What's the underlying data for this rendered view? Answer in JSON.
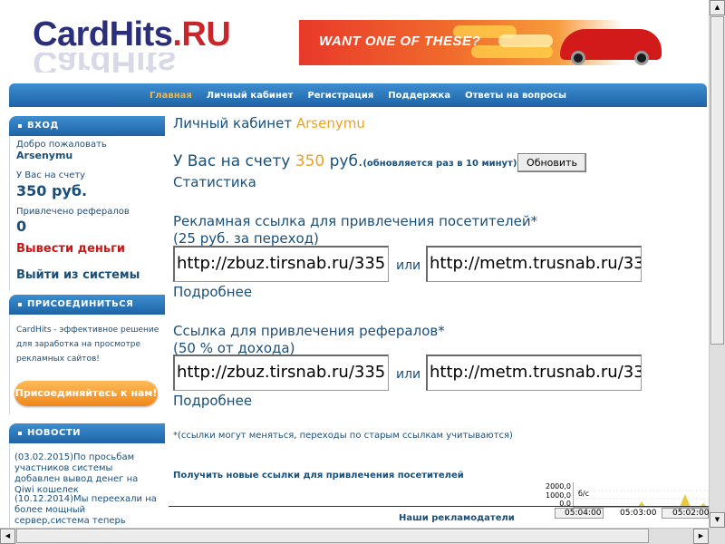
{
  "header": {
    "logo_main": "CardHits",
    "logo_tld": ".RU",
    "banner_text": "WANT ONE OF THESE?"
  },
  "nav": {
    "items": [
      {
        "label": "Главная",
        "active": true
      },
      {
        "label": "Личный кабинет"
      },
      {
        "label": "Регистрация"
      },
      {
        "label": "Поддержка"
      },
      {
        "label": "Ответы на вопросы"
      }
    ]
  },
  "sidebar": {
    "login": {
      "header": "ВХОД",
      "welcome": "Добро пожаловать",
      "username": "Arsenymu",
      "balance_label": "У Вас на счету",
      "balance": "350 руб.",
      "referrals_label": "Привлечено рефералов",
      "referrals": "0",
      "withdraw": "Вывести деньги",
      "logout": "Выйти из системы"
    },
    "join": {
      "header": "ПРИСОЕДИНИТЬСЯ",
      "text": "CardHits - эффективное решение для заработка на просмотре рекламных сайтов!",
      "button": "Присоединяйтесь к нам!"
    },
    "news": {
      "header": "НОВОСТИ",
      "items": [
        "(03.02.2015)По просьбам участников системы добавлен вывод денег на Qiwi кошелек",
        "(10.12.2014)Мы переехали на более мощный сервер,система теперь"
      ]
    }
  },
  "main": {
    "title_prefix": "Личный кабинет",
    "title_user": "Arsenymu",
    "balance_prefix": "У Вас на счету",
    "balance_amount": "350",
    "balance_suffix": "руб.",
    "balance_note": "(обновляется раз в 10 минут)",
    "refresh_button": "Обновить",
    "stats_link": "Статистика",
    "ad_link": {
      "title_line1": "Рекламная ссылка для привлечения посетителей*",
      "title_line2": "(25 руб. за переход)",
      "url1": "http://zbuz.tirsnab.ru/335",
      "url2": "http://metm.trusnab.ru/33",
      "or": "или",
      "more": "Подробнее"
    },
    "ref_link": {
      "title_line1": "Ссылка для привлечения рефералов*",
      "title_line2": "(50 % от дохода)",
      "url1": "http://zbuz.tirsnab.ru/335",
      "url2": "http://metm.trusnab.ru/33",
      "or": "или",
      "more": "Подробнее"
    },
    "footnote": "*(ссылки могут меняться, переходы по старым ссылкам учитываются)",
    "new_links": "Получить новые ссылки для привлечения посетителей",
    "advertisers": "Наши рекламодатели"
  },
  "mini_chart": {
    "y_labels": [
      "2000,0",
      "1000,0",
      "0,0"
    ],
    "unit": "б/с",
    "x_labels": [
      "05:04:00",
      "05:03:00",
      "05:02:00"
    ]
  },
  "colors": {
    "accent_blue": "#1e63a6",
    "orange": "#f0a020",
    "red": "#c8181a",
    "text": "#1a4f7a"
  }
}
